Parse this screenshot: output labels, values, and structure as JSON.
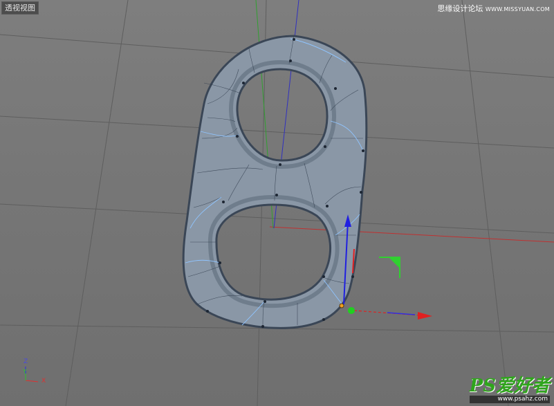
{
  "viewport": {
    "label": "透视视图",
    "background": "#777777"
  },
  "caption": {
    "site_name": "思缘设计论坛",
    "site_url": "WWW.MISSYUAN.COM"
  },
  "axis_indicator": {
    "z": "Z",
    "y": "Y",
    "x": "X"
  },
  "watermark": {
    "brand": "PS爱好者",
    "url": "www.psahz.com"
  },
  "colors": {
    "mesh_fill": "#8a97a6",
    "mesh_edge": "#3a4656",
    "mesh_lines": "#2e3a4a",
    "selection_lines": "#8fc4ff",
    "axis_x": "#e03030",
    "axis_y": "#30c030",
    "axis_z": "#3030e0"
  }
}
